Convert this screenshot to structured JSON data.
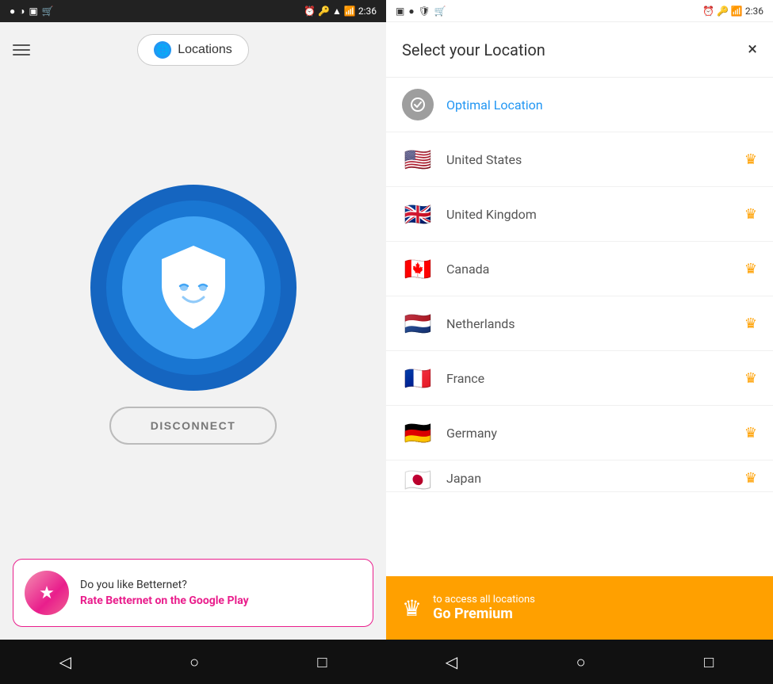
{
  "left": {
    "status": {
      "time": "2:36",
      "left_icons": [
        "●",
        "◑",
        "▣",
        "🛒"
      ],
      "right_icons": [
        "⏰",
        "🔑",
        "📶",
        "▲",
        "📶",
        "2:36"
      ]
    },
    "header": {
      "menu_label": "Menu",
      "locations_btn": "Locations"
    },
    "vpn": {
      "status": "connected",
      "shield_label": "Shield"
    },
    "disconnect_btn": "DISCONNECT",
    "promo": {
      "title": "Do you like Betternet?",
      "link": "Rate Betternet on the Google Play"
    },
    "nav": [
      "◁",
      "○",
      "□"
    ]
  },
  "right": {
    "status": {
      "time": "2:36",
      "left_icons": [
        "▣",
        "●",
        "🛡",
        "🛒"
      ],
      "right_icons": [
        "⏰",
        "🔑",
        "📶",
        "▲",
        "📶",
        "2:36"
      ]
    },
    "header": {
      "title": "Select your Location",
      "close": "×"
    },
    "locations": [
      {
        "id": "optimal",
        "name": "Optimal Location",
        "premium": false,
        "flag": "optimal"
      },
      {
        "id": "us",
        "name": "United States",
        "premium": true,
        "flag": "🇺🇸"
      },
      {
        "id": "uk",
        "name": "United Kingdom",
        "premium": true,
        "flag": "🇬🇧"
      },
      {
        "id": "ca",
        "name": "Canada",
        "premium": true,
        "flag": "🇨🇦"
      },
      {
        "id": "nl",
        "name": "Netherlands",
        "premium": true,
        "flag": "🇳🇱"
      },
      {
        "id": "fr",
        "name": "France",
        "premium": true,
        "flag": "🇫🇷"
      },
      {
        "id": "de",
        "name": "Germany",
        "premium": true,
        "flag": "🇩🇪"
      },
      {
        "id": "jp",
        "name": "Japan",
        "premium": true,
        "flag": "🇯🇵"
      }
    ],
    "premium": {
      "sub": "to access all locations",
      "main": "Go Premium"
    },
    "nav": [
      "◁",
      "○",
      "□"
    ]
  }
}
